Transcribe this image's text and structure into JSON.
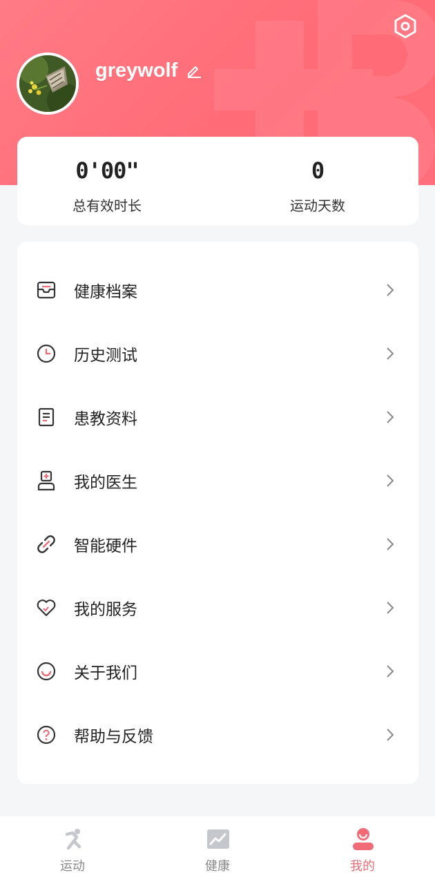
{
  "profile": {
    "username": "greywolf"
  },
  "stats": [
    {
      "value": "0'00\"",
      "label": "总有效时长"
    },
    {
      "value": "0",
      "label": "运动天数"
    }
  ],
  "menu": [
    {
      "label": "健康档案",
      "icon": "health-record-icon"
    },
    {
      "label": "历史测试",
      "icon": "clock-icon"
    },
    {
      "label": "患教资料",
      "icon": "document-icon"
    },
    {
      "label": "我的医生",
      "icon": "doctor-icon"
    },
    {
      "label": "智能硬件",
      "icon": "link-icon"
    },
    {
      "label": "我的服务",
      "icon": "heart-icon"
    },
    {
      "label": "关于我们",
      "icon": "smile-icon"
    },
    {
      "label": "帮助与反馈",
      "icon": "help-icon"
    }
  ],
  "tabs": [
    {
      "label": "运动",
      "icon": "exercise-icon",
      "active": false
    },
    {
      "label": "健康",
      "icon": "health-chart-icon",
      "active": false
    },
    {
      "label": "我的",
      "icon": "profile-icon",
      "active": true
    }
  ],
  "colors": {
    "accent": "#ff6e7a",
    "active_tab": "#f06b76",
    "background": "#f5f6f8"
  }
}
